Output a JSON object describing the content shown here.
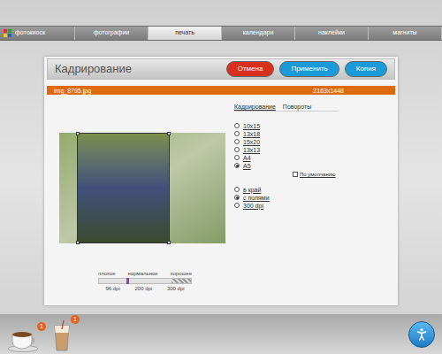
{
  "app": {
    "logo": "фотокиоск"
  },
  "tabs": [
    {
      "label": "фотографии",
      "selected": false
    },
    {
      "label": "печать",
      "selected": true
    },
    {
      "label": "календари",
      "selected": false
    },
    {
      "label": "наклейки",
      "selected": false
    },
    {
      "label": "магниты",
      "selected": false
    }
  ],
  "panel": {
    "title": "Кадрирование",
    "buttons": [
      {
        "label": "Отмена",
        "color": "#d8301c"
      },
      {
        "label": "Применить",
        "color": "#1a9ad8"
      },
      {
        "label": "Копия",
        "color": "#1a9ad8"
      }
    ]
  },
  "file": {
    "name": "img_8795.jpg",
    "size": "2163x1448"
  },
  "subtabs": [
    {
      "label": "Кадрирование",
      "selected": true
    },
    {
      "label": "Повороты",
      "selected": false
    }
  ],
  "formats": [
    {
      "label": "10x15",
      "selected": false
    },
    {
      "label": "13x18",
      "selected": false
    },
    {
      "label": "15x20",
      "selected": false
    },
    {
      "label": "13x13",
      "selected": false
    },
    {
      "label": "A4",
      "selected": false
    },
    {
      "label": "A5",
      "selected": true
    }
  ],
  "default_option": {
    "label": "По умолчанию",
    "checked": false
  },
  "fit": [
    {
      "label": "в край",
      "selected": false
    },
    {
      "label": "с полями",
      "selected": true
    },
    {
      "label": "300 dpi",
      "selected": false
    }
  ],
  "quality": {
    "labels": [
      "плохое",
      "нормальное",
      "хорошее"
    ],
    "ticks": [
      "96 dpi",
      "200 dpi",
      "300 dpi"
    ],
    "level": 0.3
  },
  "tray": [
    {
      "kind": "cup",
      "badge": "1"
    },
    {
      "kind": "glass",
      "badge": "1"
    }
  ]
}
